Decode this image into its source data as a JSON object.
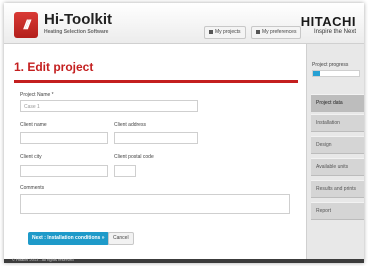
{
  "header": {
    "app_name": "Hi-Toolkit",
    "app_subtitle": "Heating Selection Software",
    "my_projects": "My projects",
    "my_preferences": "My preferences",
    "brand": "HITACHI",
    "brand_tagline": "Inspire the Next"
  },
  "form": {
    "page_title": "1. Edit project",
    "project_name_label": "Project Name *",
    "project_name_value": "Case 1",
    "client_name_label": "Client name",
    "client_address_label": "Client address",
    "client_city_label": "Client city",
    "client_postal_code_label": "Client postal code",
    "comments_label": "Comments",
    "next_button": "Next : Installation conditions »",
    "cancel_button": "Cancel"
  },
  "sidebar": {
    "progress_label": "Project progress",
    "progress_value": 0.15,
    "steps": [
      {
        "label": "Project data"
      },
      {
        "label": "Installation"
      },
      {
        "label": "Design"
      },
      {
        "label": "Available units"
      },
      {
        "label": "Results and prints"
      },
      {
        "label": "Report"
      }
    ]
  },
  "footer": {
    "copyright": "© Hitachi 2013 - All rights reserved"
  }
}
